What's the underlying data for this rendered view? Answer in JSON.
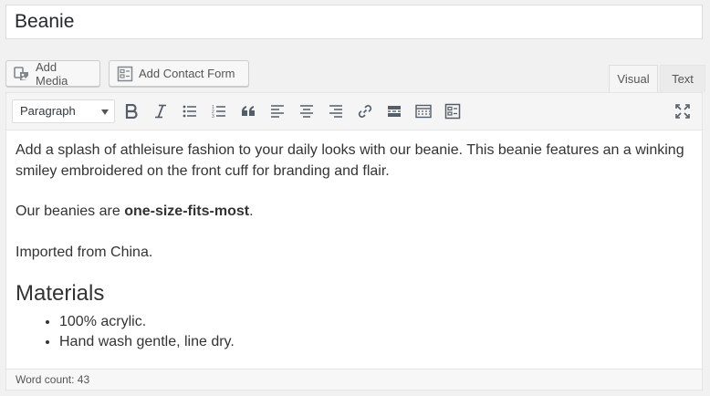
{
  "post_title": "Beanie",
  "media_buttons": {
    "add_media": "Add Media",
    "add_contact_form": "Add Contact Form"
  },
  "tabs": {
    "visual": "Visual",
    "text": "Text"
  },
  "toolbar": {
    "format_value": "Paragraph",
    "icons": [
      "bold-icon",
      "italic-icon",
      "bulleted-list-icon",
      "numbered-list-icon",
      "blockquote-icon",
      "align-left-icon",
      "align-center-icon",
      "align-right-icon",
      "link-icon",
      "read-more-icon",
      "toolbar-toggle-icon",
      "form-icon",
      "fullscreen-icon"
    ]
  },
  "content": {
    "para1": "Add a splash of athleisure fashion to your daily looks with our beanie. This beanie features an a winking smiley embroidered on the front cuff for branding and flair.",
    "para2_prefix": "Our beanies are ",
    "para2_bold": "one-size-fits-most",
    "para2_suffix": ".",
    "para3": "Imported from China.",
    "heading": "Materials",
    "list": [
      "100% acrylic.",
      "Hand wash gentle, line dry."
    ]
  },
  "status": {
    "word_count": "Word count: 43"
  },
  "colors": {
    "icon": "#555d66",
    "border": "#dddddd",
    "background": "#f1f1f1"
  }
}
